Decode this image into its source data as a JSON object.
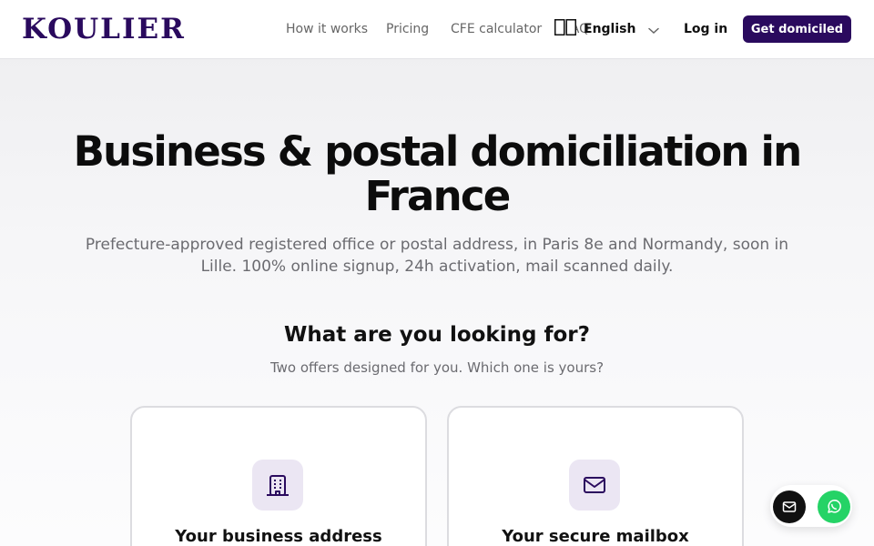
{
  "header": {
    "logo": "KOULIER",
    "nav": [
      "How it works",
      "Pricing",
      "CFE calculator",
      "FAQ"
    ],
    "language": "English",
    "login": "Log in",
    "cta": "Get domiciled"
  },
  "hero": {
    "title": "Business & postal domiciliation in France",
    "subtitle": "Prefecture-approved registered office or postal address, in Paris 8e and Normandy, soon in Lille. 100% online signup, 24h activation, mail scanned daily."
  },
  "offers": {
    "title": "What are you looking for?",
    "subtitle": "Two offers designed for you. Which one is yours?",
    "cards": [
      {
        "title": "Your business address",
        "icon": "building-icon"
      },
      {
        "title": "Your secure mailbox",
        "icon": "mail-icon"
      }
    ]
  },
  "floating": {
    "icons": [
      "mail-icon",
      "whatsapp-icon"
    ]
  },
  "colors": {
    "brand": "#2a0a5e",
    "icon_bg": "#ebe6f3",
    "whatsapp": "#25d366"
  }
}
